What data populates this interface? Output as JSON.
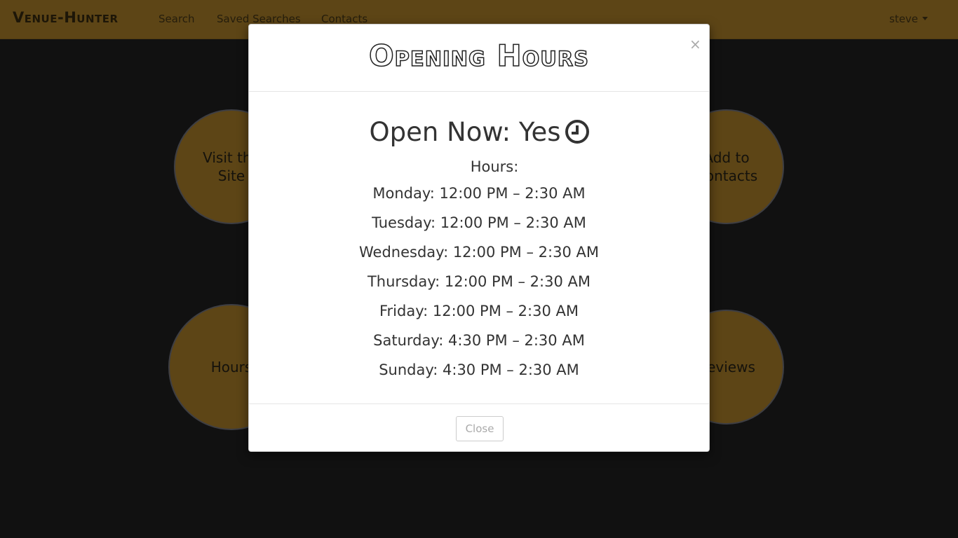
{
  "navbar": {
    "brand": "Venue-Hunter",
    "links": [
      "Search",
      "Saved Searches",
      "Contacts"
    ],
    "user": "steve"
  },
  "background_circles": {
    "visit_site": "Visit the\nSite",
    "add_contacts": "Add to\nContacts",
    "hours": "Hours",
    "reviews": "Reviews"
  },
  "modal": {
    "title": "Opening Hours",
    "close_symbol": "×",
    "open_now": "Open Now: Yes",
    "hours_label": "Hours:",
    "hours": [
      "Monday: 12:00 PM – 2:30 AM",
      "Tuesday: 12:00 PM – 2:30 AM",
      "Wednesday: 12:00 PM – 2:30 AM",
      "Thursday: 12:00 PM – 2:30 AM",
      "Friday: 12:00 PM – 2:30 AM",
      "Saturday: 4:30 PM – 2:30 AM",
      "Sunday: 4:30 PM – 2:30 AM"
    ],
    "close_button": "Close"
  },
  "colors": {
    "navbar": "#ba8b2c",
    "circle": "#ba8b2c",
    "page_background": "#222222"
  }
}
